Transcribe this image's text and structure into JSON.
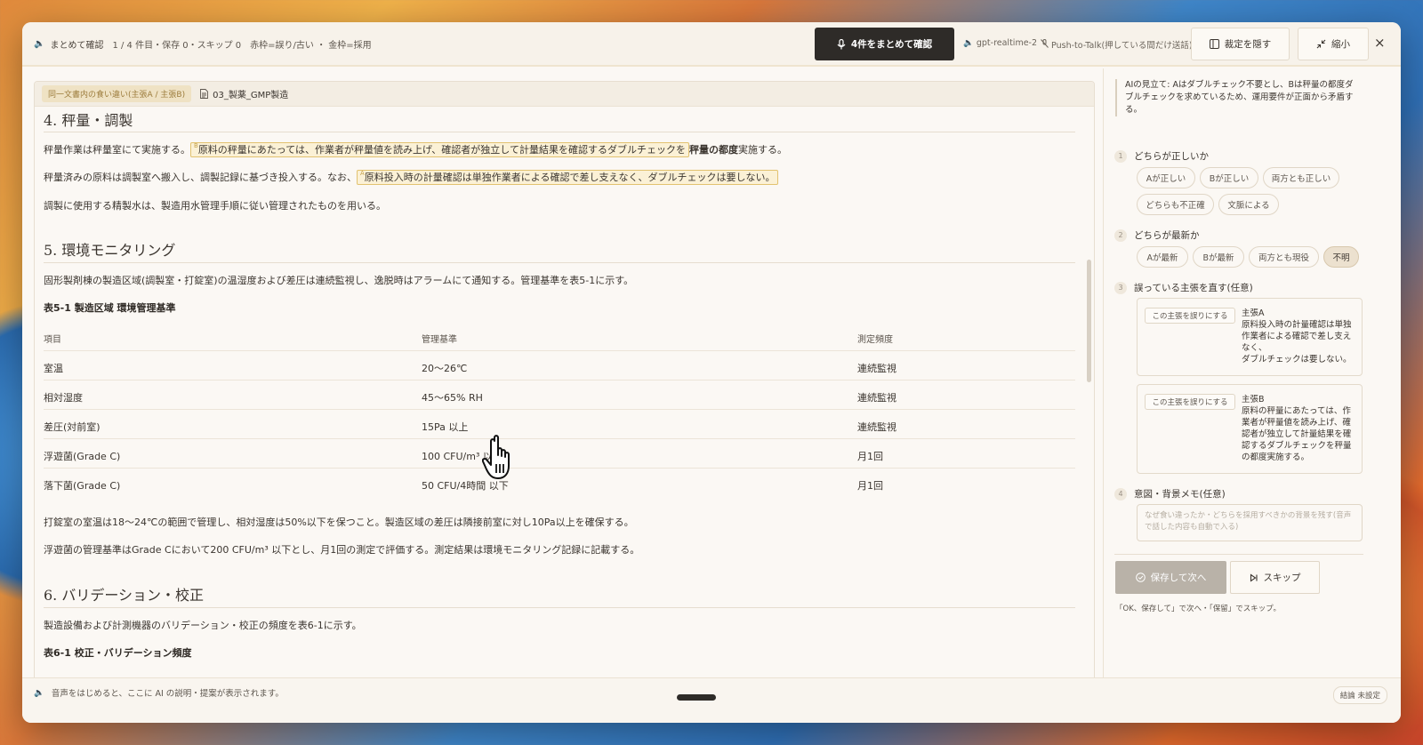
{
  "topbar": {
    "title": "まとめて確認",
    "progress": "1 / 4 件目・保存 0・スキップ 0",
    "legend": "赤枠=誤り/古い ・ 金枠=採用",
    "confirm_button": "4件をまとめて確認",
    "model": "gpt-realtime-2",
    "ptt": "Push-to-Talk(押している間だけ送話)",
    "hide_button": "裁定を隠す",
    "shrink_button": "縮小",
    "close_glyph": "×"
  },
  "doc": {
    "tag": "同一文書内の食い違い(主張A / 主張B)",
    "filename": "03_製薬_GMP製造",
    "sec4_title": "4. 秤量・調製",
    "p1_pre": "秤量作業は秤量室にて実施する。",
    "p1_hl": "原料の秤量にあたっては、作業者が秤量値を読み上げ、確認者が独立して計量結果を確認するダブルチェックを",
    "p1_bold": "秤量の都度",
    "p1_post": "実施する。",
    "p2_pre": "秤量済みの原料は調製室へ搬入し、調製記録に基づき投入する。なお、",
    "p2_hl": "原料投入時の計量確認は単独作業者による確認で差し支えなく、ダブルチェックは要しない。",
    "p3": "調製に使用する精製水は、製造用水管理手順に従い管理されたものを用いる。",
    "sec5_title": "5. 環境モニタリング",
    "p4": "固形製剤棟の製造区域(調製室・打錠室)の温湿度および差圧は連続監視し、逸脱時はアラームにて通知する。管理基準を表5-1に示す。",
    "table_title": "表5-1 製造区域 環境管理基準",
    "table_headers": [
      "項目",
      "管理基準",
      "測定頻度"
    ],
    "table_rows": [
      [
        "室温",
        "20〜26℃",
        "連続監視"
      ],
      [
        "相対湿度",
        "45〜65% RH",
        "連続監視"
      ],
      [
        "差圧(対前室)",
        "15Pa 以上",
        "連続監視"
      ],
      [
        "浮遊菌(Grade C)",
        "100 CFU/m³ 以下",
        "月1回"
      ],
      [
        "落下菌(Grade C)",
        "50 CFU/4時間 以下",
        "月1回"
      ]
    ],
    "p5": "打錠室の室温は18〜24℃の範囲で管理し、相対湿度は50%以下を保つこと。製造区域の差圧は隣接前室に対し10Pa以上を確保する。",
    "p6": "浮遊菌の管理基準はGrade Cにおいて200 CFU/m³ 以下とし、月1回の測定で評価する。測定結果は環境モニタリング記録に記載する。",
    "sec6_title": "6. バリデーション・校正",
    "p7": "製造設備および計測機器のバリデーション・校正の頻度を表6-1に示す。",
    "table2_title": "表6-1 校正・バリデーション頻度"
  },
  "panel": {
    "ai_note": "AIの見立て: Aはダブルチェック不要とし、Bは秤量の都度ダブルチェックを求めているため、運用要件が正面から矛盾する。",
    "q1": {
      "num": "1",
      "label": "どちらが正しいか",
      "options": [
        "Aが正しい",
        "Bが正しい",
        "両方とも正しい",
        "どちらも不正確",
        "文脈による"
      ]
    },
    "q2": {
      "num": "2",
      "label": "どちらが最新か",
      "options": [
        "Aが最新",
        "Bが最新",
        "両方とも現役",
        "不明"
      ],
      "selected": "不明"
    },
    "q3": {
      "num": "3",
      "label": "誤っている主張を直す(任意)",
      "claim_button": "この主張を誤りにする",
      "claim_a_label": "主張A",
      "claim_a_text": "原料投入時の計量確認は単独作業者による確認で差し支えなく、\nダブルチェックは要しない。",
      "claim_b_label": "主張B",
      "claim_b_text": "原料の秤量にあたっては、作業者が秤量値を読み上げ、確認者が独立して計量結果を確認するダブルチェックを秤量の都度実施する。"
    },
    "q4": {
      "num": "4",
      "label": "意図・背景メモ(任意)",
      "placeholder": "なぜ食い違ったか・どちらを採用すべきかの背景を残す(音声で話した内容も自動で入る)"
    },
    "save_button": "保存して次へ",
    "skip_button": "スキップ",
    "hint": "「OK、保存して」で次へ・「保留」でスキップ。"
  },
  "status": {
    "text": "音声をはじめると、ここに AI の説明・提案が表示されます。",
    "verdict": "結論 未設定"
  }
}
